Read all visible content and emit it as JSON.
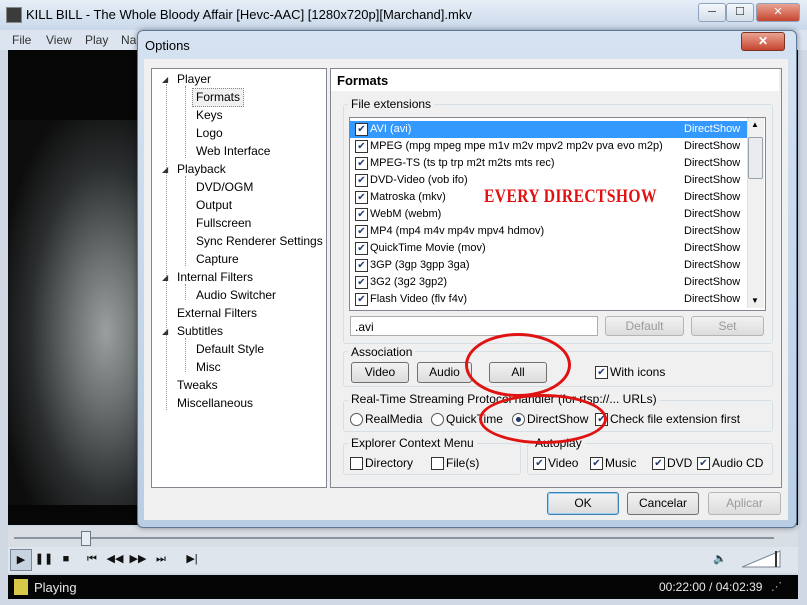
{
  "main_window": {
    "title": "KILL BILL - The Whole Bloody Affair [Hevc-AAC] [1280x720p][Marchand].mkv",
    "menu": [
      "File",
      "View",
      "Play",
      "Na"
    ],
    "status_text": "Playing",
    "time": "00:22:00 / 04:02:39"
  },
  "dialog": {
    "title": "Options",
    "close_label": "✕",
    "tree": [
      {
        "label": "Player",
        "children": [
          "Formats",
          "Keys",
          "Logo",
          "Web Interface"
        ]
      },
      {
        "label": "Playback",
        "children": [
          "DVD/OGM",
          "Output",
          "Fullscreen",
          "Sync Renderer Settings",
          "Capture"
        ]
      },
      {
        "label": "Internal Filters",
        "children": [
          "Audio Switcher"
        ]
      },
      {
        "label": "External Filters",
        "children": []
      },
      {
        "label": "Subtitles",
        "children": [
          "Default Style",
          "Misc"
        ]
      },
      {
        "label": "Tweaks",
        "children": []
      },
      {
        "label": "Miscellaneous",
        "children": []
      }
    ],
    "page_title": "Formats",
    "file_extensions": {
      "label": "File extensions",
      "rows": [
        {
          "name": "AVI (avi)",
          "handler": "DirectShow",
          "checked": true,
          "selected": true
        },
        {
          "name": "MPEG (mpg mpeg mpe m1v m2v mpv2 mp2v pva evo m2p)",
          "handler": "DirectShow",
          "checked": true
        },
        {
          "name": "MPEG-TS (ts tp trp m2t m2ts mts rec)",
          "handler": "DirectShow",
          "checked": true
        },
        {
          "name": "DVD-Video (vob ifo)",
          "handler": "DirectShow",
          "checked": true
        },
        {
          "name": "Matroska (mkv)",
          "handler": "DirectShow",
          "checked": true
        },
        {
          "name": "WebM (webm)",
          "handler": "DirectShow",
          "checked": true
        },
        {
          "name": "MP4 (mp4 m4v mp4v mpv4 hdmov)",
          "handler": "DirectShow",
          "checked": true
        },
        {
          "name": "QuickTime Movie (mov)",
          "handler": "DirectShow",
          "checked": true
        },
        {
          "name": "3GP (3gp 3gpp 3ga)",
          "handler": "DirectShow",
          "checked": true
        },
        {
          "name": "3G2 (3g2 3gp2)",
          "handler": "DirectShow",
          "checked": true
        },
        {
          "name": "Flash Video (flv f4v)",
          "handler": "DirectShow",
          "checked": true
        }
      ],
      "ext_value": ".avi",
      "default_label": "Default",
      "set_label": "Set"
    },
    "association": {
      "label": "Association",
      "video_label": "Video",
      "audio_label": "Audio",
      "all_label": "All",
      "with_icons_label": "With icons",
      "with_icons_checked": true
    },
    "rtsp": {
      "label": "Real-Time Streaming Protocol handler (for rtsp://... URLs)",
      "options": [
        "RealMedia",
        "QuickTime",
        "DirectShow"
      ],
      "selected": "DirectShow",
      "check_ext_label": "Check file extension first",
      "check_ext_checked": true
    },
    "explorer": {
      "label": "Explorer Context Menu",
      "directory_label": "Directory",
      "files_label": "File(s)"
    },
    "autoplay": {
      "label": "Autoplay",
      "items": [
        "Video",
        "Music",
        "DVD",
        "Audio CD"
      ]
    },
    "ok_label": "OK",
    "cancel_label": "Cancelar",
    "apply_label": "Aplicar"
  },
  "annotation": {
    "text": "EVERY DIRECTSHOW",
    "color": "#e21010"
  },
  "check_glyph": "✔"
}
